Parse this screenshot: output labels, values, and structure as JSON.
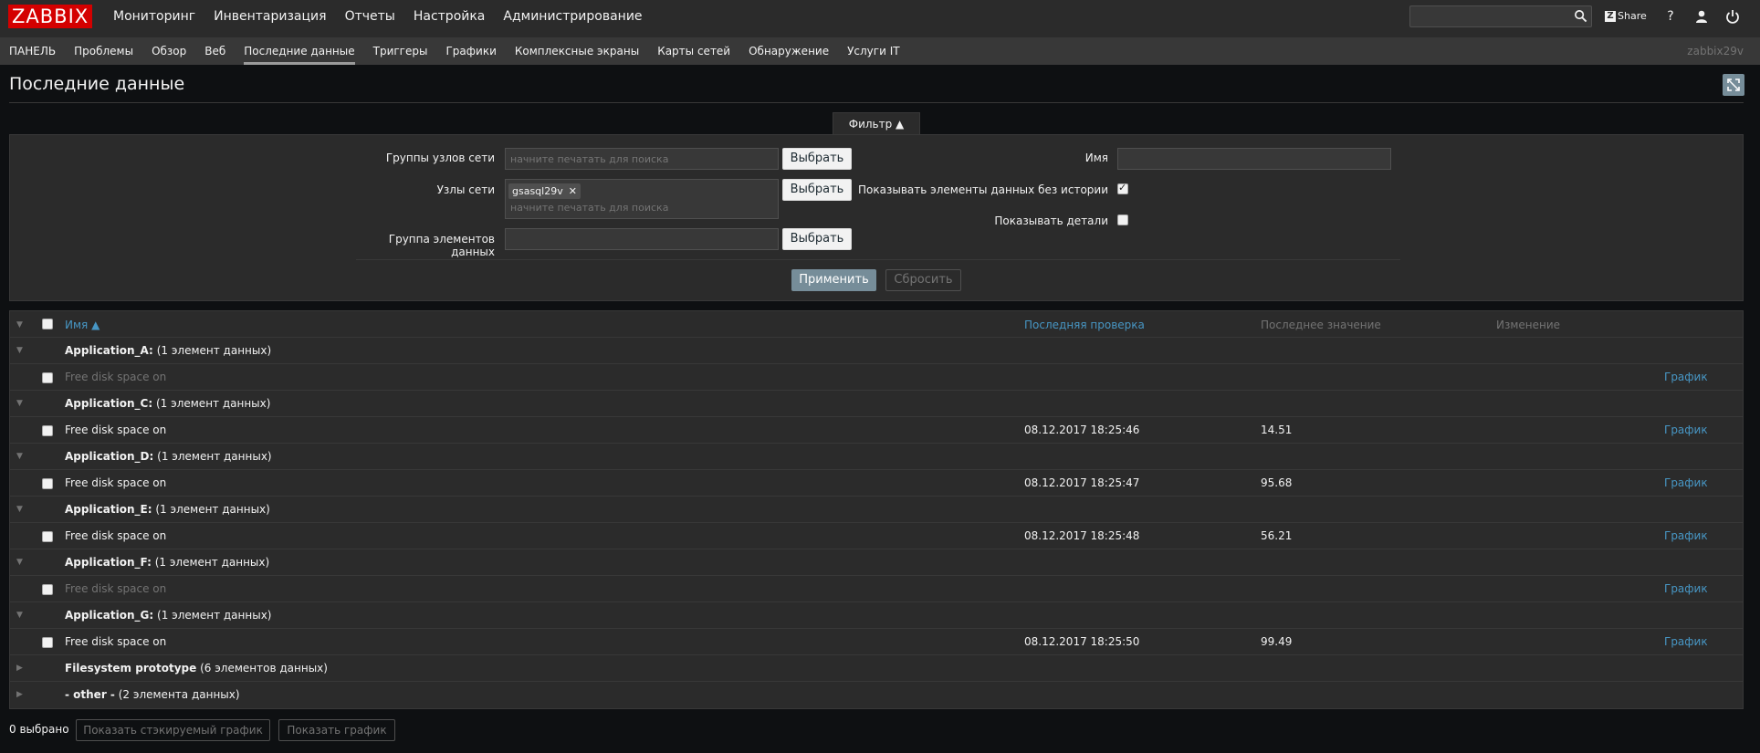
{
  "topbar": {
    "logo": "ZABBIX",
    "menu": [
      "Мониторинг",
      "Инвентаризация",
      "Отчеты",
      "Настройка",
      "Администрирование"
    ],
    "share_label": "Share",
    "search_value": ""
  },
  "submenu": {
    "items": [
      "ПАНЕЛЬ",
      "Проблемы",
      "Обзор",
      "Веб",
      "Последние данные",
      "Триггеры",
      "Графики",
      "Комплексные экраны",
      "Карты сетей",
      "Обнаружение",
      "Услуги IT"
    ],
    "active": "Последние данные",
    "host": "zabbix29v"
  },
  "page": {
    "title": "Последние данные"
  },
  "filter": {
    "tab_label": "Фильтр ▲",
    "host_groups_label": "Группы узлов сети",
    "host_groups_placeholder": "начните печатать для поиска",
    "hosts_label": "Узлы сети",
    "hosts_selected": "gsasql29v",
    "hosts_placeholder": "начните печатать для поиска",
    "app_label": "Группа элементов данных",
    "app_value": "",
    "select_label": "Выбрать",
    "name_label": "Имя",
    "name_value": "",
    "show_without_history_label": "Показывать элементы данных без истории",
    "show_without_history": true,
    "show_details_label": "Показывать детали",
    "show_details": false,
    "apply_label": "Применить",
    "reset_label": "Сбросить"
  },
  "table": {
    "headers": {
      "name": "Имя ▲",
      "last_check": "Последняя проверка",
      "last_value": "Последнее значение",
      "change": "Изменение"
    },
    "graph_label": "График",
    "groups": [
      {
        "name": "Application_A:",
        "count": "(1 элемент данных)",
        "items": [
          {
            "name": "Free disk space on",
            "last_check": "",
            "last_value": "",
            "dim": true
          }
        ]
      },
      {
        "name": "Application_C:",
        "count": "(1 элемент данных)",
        "items": [
          {
            "name": "Free disk space on",
            "last_check": "08.12.2017 18:25:46",
            "last_value": "14.51",
            "dim": false
          }
        ]
      },
      {
        "name": "Application_D:",
        "count": "(1 элемент данных)",
        "items": [
          {
            "name": "Free disk space on",
            "last_check": "08.12.2017 18:25:47",
            "last_value": "95.68",
            "dim": false
          }
        ]
      },
      {
        "name": "Application_E:",
        "count": "(1 элемент данных)",
        "items": [
          {
            "name": "Free disk space on",
            "last_check": "08.12.2017 18:25:48",
            "last_value": "56.21",
            "dim": false
          }
        ]
      },
      {
        "name": "Application_F:",
        "count": "(1 элемент данных)",
        "items": [
          {
            "name": "Free disk space on",
            "last_check": "",
            "last_value": "",
            "dim": true
          }
        ]
      },
      {
        "name": "Application_G:",
        "count": "(1 элемент данных)",
        "items": [
          {
            "name": "Free disk space on",
            "last_check": "08.12.2017 18:25:50",
            "last_value": "99.49",
            "dim": false
          }
        ]
      }
    ],
    "collapsed_groups": [
      {
        "name": "Filesystem prototype",
        "count": "(6 элементов данных)"
      },
      {
        "name": "- other -",
        "count": "(2 элемента данных)"
      }
    ]
  },
  "footer": {
    "selected": "0 выбрано",
    "stacked_graph_label": "Показать стэкируемый график",
    "graph_label": "Показать график"
  }
}
